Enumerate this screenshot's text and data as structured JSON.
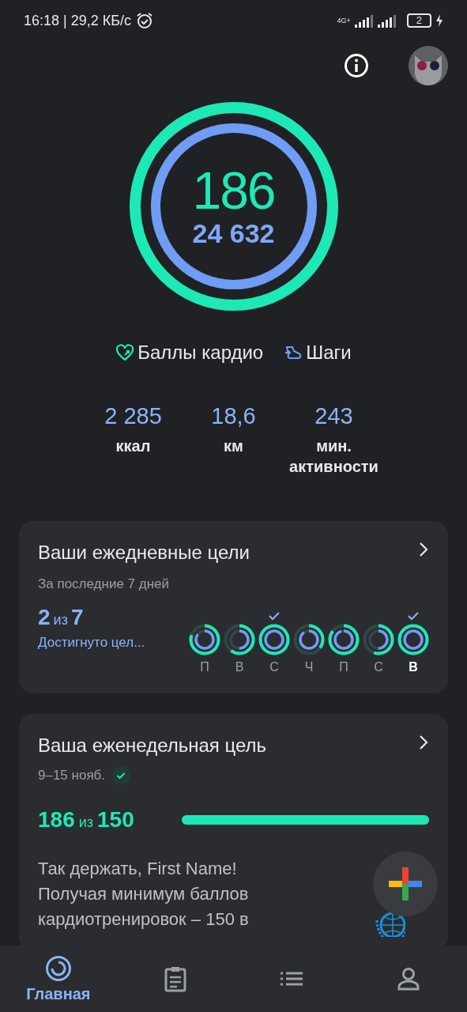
{
  "status_bar": {
    "time": "16:18",
    "speed": "| 29,2 КБ/с",
    "network": "4G+",
    "battery": "2"
  },
  "summary": {
    "cardio_points": "186",
    "steps": "24 632",
    "cardio_ring": {
      "level": 1
    },
    "steps_ring": {
      "level": 1
    }
  },
  "legend": [
    {
      "kind": "heart",
      "label": "Баллы кардио"
    },
    {
      "kind": "steps",
      "label": "Шаги"
    }
  ],
  "stats": [
    {
      "value": "2 285",
      "label": "ккал"
    },
    {
      "value": "18,6",
      "label": "км"
    },
    {
      "value": "243",
      "label": "мин.\nактивности"
    }
  ],
  "daily_goals": {
    "title": "Ваши ежедневные цели",
    "subtitle": "За последние 7 дней",
    "achieved": "2",
    "of_word": "из",
    "total": "7",
    "caption": "Достигнуто цел...",
    "days": [
      {
        "label": "П",
        "checked": false,
        "selected": false
      },
      {
        "label": "В",
        "checked": false,
        "selected": false
      },
      {
        "label": "С",
        "checked": true,
        "selected": false
      },
      {
        "label": "Ч",
        "checked": false,
        "selected": false
      },
      {
        "label": "П",
        "checked": false,
        "selected": false
      },
      {
        "label": "С",
        "checked": false,
        "selected": false
      },
      {
        "label": "В",
        "checked": true,
        "selected": true
      }
    ]
  },
  "weekly_goal": {
    "title": "Ваша еженедельная цель",
    "dates": "9–15 нояб.",
    "checked": true,
    "value": "186",
    "of_word": "из",
    "target": "150",
    "level": 1,
    "message": "Так держать, First Name!\nПолучая минимум баллов кардиотренировок – 150 в"
  },
  "bottom_nav": [
    {
      "kind": "home",
      "label": "Главная",
      "selected": true
    },
    {
      "kind": "journal",
      "selected": false
    },
    {
      "kind": "list",
      "selected": false
    },
    {
      "kind": "profile",
      "selected": false
    }
  ]
}
